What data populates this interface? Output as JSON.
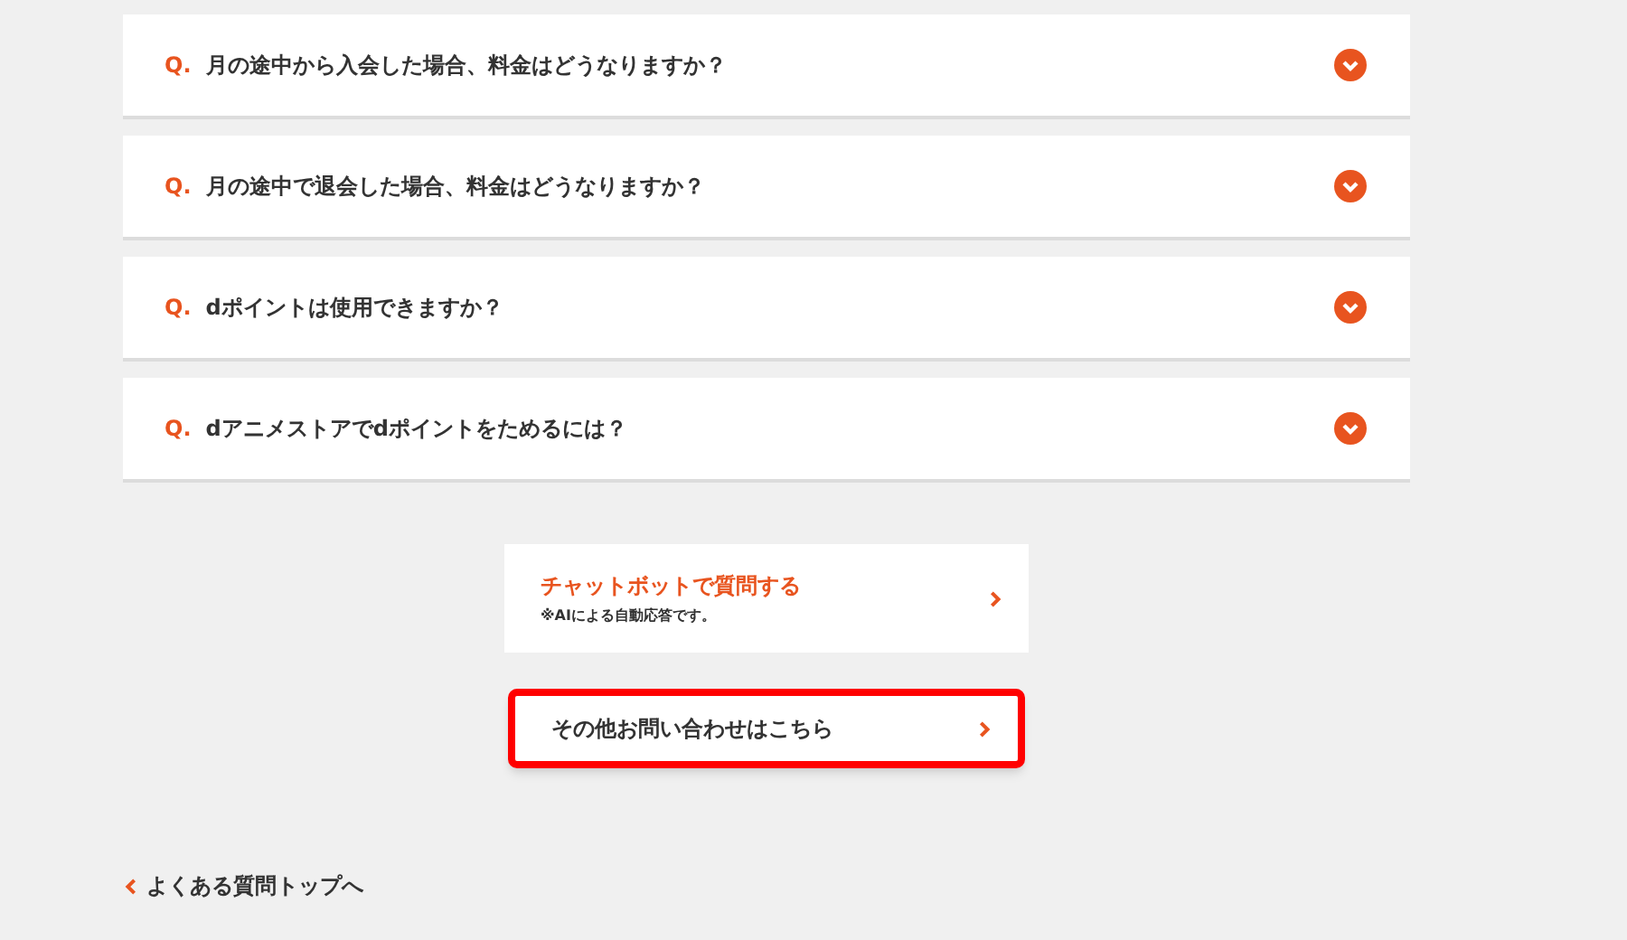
{
  "faq": [
    {
      "marker": "Q.",
      "question": "月の途中から入会した場合、料金はどうなりますか？",
      "expanded": false
    },
    {
      "marker": "Q.",
      "question": "月の途中で退会した場合、料金はどうなりますか？",
      "expanded": false
    },
    {
      "marker": "Q.",
      "question": "dポイントは使用できますか？",
      "expanded": false
    },
    {
      "marker": "Q.",
      "question": "dアニメストアでdポイントをためるには？",
      "expanded": false
    }
  ],
  "links": [
    {
      "kind": "chatbot",
      "title": "チャットボットで質問する",
      "note": "※AIによる自動応答です。",
      "highlighted": false
    },
    {
      "kind": "contact",
      "title": "その他お問い合わせはこちら",
      "highlighted": true
    }
  ],
  "back_link": "よくある質問トップへ"
}
